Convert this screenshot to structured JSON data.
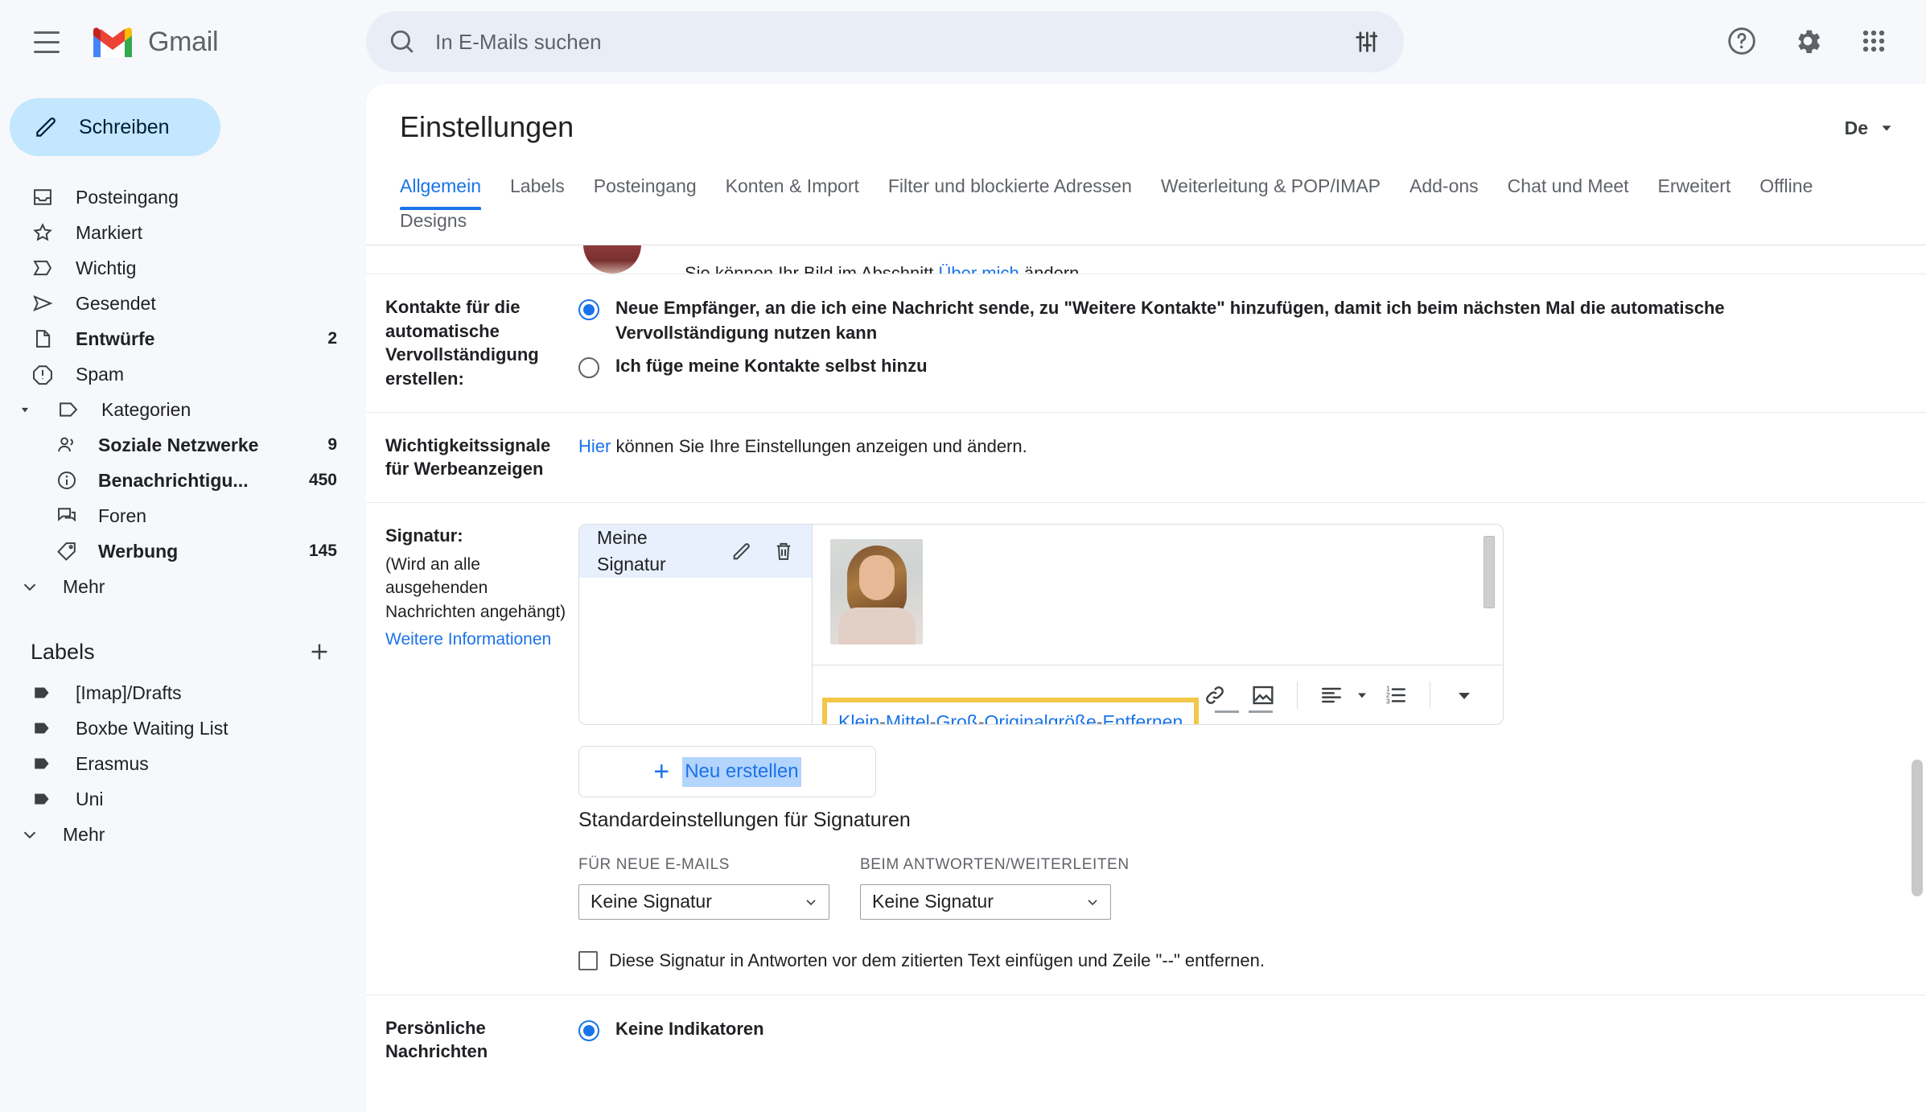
{
  "topbar": {
    "menu_icon": "hamburger-icon",
    "brand": "Gmail",
    "search": {
      "placeholder": "In E-Mails suchen",
      "value": "",
      "search_icon": "search-icon",
      "filter_icon": "tune-icon"
    },
    "help_icon": "help-circle-icon",
    "settings_icon": "gear-icon",
    "apps_icon": "apps-grid-icon"
  },
  "sidebar": {
    "compose": {
      "label": "Schreiben",
      "icon": "pencil-icon"
    },
    "items": [
      {
        "label": "Posteingang",
        "icon": "inbox-icon",
        "count": "",
        "bold": false
      },
      {
        "label": "Markiert",
        "icon": "star-icon",
        "count": "",
        "bold": false
      },
      {
        "label": "Wichtig",
        "icon": "important-icon",
        "count": "",
        "bold": false
      },
      {
        "label": "Gesendet",
        "icon": "send-icon",
        "count": "",
        "bold": false
      },
      {
        "label": "Entwürfe",
        "icon": "draft-icon",
        "count": "2",
        "bold": true
      },
      {
        "label": "Spam",
        "icon": "spam-icon",
        "count": "",
        "bold": false
      }
    ],
    "categories": {
      "label": "Kategorien",
      "icon": "label-icon",
      "expanded": true,
      "items": [
        {
          "label": "Soziale Netzwerke",
          "icon": "people-icon",
          "count": "9",
          "bold": true
        },
        {
          "label": "Benachrichtigu...",
          "icon": "info-icon",
          "count": "450",
          "bold": true
        },
        {
          "label": "Foren",
          "icon": "forum-icon",
          "count": "",
          "bold": false
        },
        {
          "label": "Werbung",
          "icon": "tag-icon",
          "count": "145",
          "bold": true
        }
      ],
      "more": "Mehr"
    },
    "labels_header": {
      "title": "Labels",
      "add_icon": "plus-icon"
    },
    "labels": [
      {
        "label": "[Imap]/Drafts",
        "icon": "label-filled-icon"
      },
      {
        "label": "Boxbe Waiting List",
        "icon": "label-filled-icon"
      },
      {
        "label": "Erasmus",
        "icon": "label-filled-icon"
      },
      {
        "label": "Uni",
        "icon": "label-filled-icon"
      }
    ],
    "labels_more": "Mehr"
  },
  "settings": {
    "title": "Einstellungen",
    "language": {
      "label": "De",
      "icon": "chevron-down-icon"
    },
    "tabs": [
      {
        "label": "Allgemein",
        "active": true
      },
      {
        "label": "Labels",
        "active": false
      },
      {
        "label": "Posteingang",
        "active": false
      },
      {
        "label": "Konten & Import",
        "active": false
      },
      {
        "label": "Filter und blockierte Adressen",
        "active": false
      },
      {
        "label": "Weiterleitung & POP/IMAP",
        "active": false
      },
      {
        "label": "Add-ons",
        "active": false
      },
      {
        "label": "Chat und Meet",
        "active": false
      },
      {
        "label": "Erweitert",
        "active": false
      },
      {
        "label": "Offline",
        "active": false
      },
      {
        "label": "Designs",
        "active": false
      }
    ],
    "clipped_row": {
      "text_before": "Sie können Ihr Bild im Abschnitt ",
      "link": "Über mich",
      "text_after": " ändern."
    },
    "contacts": {
      "label": "Kontakte für die automatische Vervollständigung erstellen:",
      "option1": "Neue Empfänger, an die ich eine Nachricht sende, zu \"Weitere Kontakte\" hinzufügen, damit ich beim nächsten Mal die automatische Vervollständigung nutzen kann",
      "option2": "Ich füge meine Kontakte selbst hinzu",
      "selected": 1
    },
    "importance": {
      "label": "Wichtigkeitssignale für Werbeanzeigen",
      "link": "Hier",
      "text": " können Sie Ihre Einstellungen anzeigen und ändern."
    },
    "signature": {
      "label": "Signatur:",
      "sub": "(Wird an alle ausgehenden Nachrichten angehängt)",
      "more_link": "Weitere Informationen",
      "list": [
        {
          "name": "Meine Signatur",
          "edit_icon": "pencil-icon",
          "delete_icon": "trash-icon",
          "selected": true
        }
      ],
      "image_alt": "portrait-photo",
      "size_links": [
        {
          "label": "Klein"
        },
        {
          "label": "Mittel"
        },
        {
          "label": "Groß"
        },
        {
          "label": "Originalgröße"
        },
        {
          "label": "Entfernen"
        }
      ],
      "size_separator": "-",
      "toolbar": [
        {
          "icon": "link-icon"
        },
        {
          "icon": "insert-image-icon"
        },
        {
          "icon": "align-left-icon"
        },
        {
          "icon": "numbered-list-icon"
        },
        {
          "icon": "more-options-icon"
        }
      ],
      "new_button": {
        "plus": "+",
        "label": "Neu erstellen"
      },
      "defaults_title": "Standardeinstellungen für Signaturen",
      "default_new": {
        "caption": "FÜR NEUE E-MAILS",
        "value": "Keine Signatur"
      },
      "default_reply": {
        "caption": "BEIM ANTWORTEN/WEITERLEITEN",
        "value": "Keine Signatur"
      },
      "checkbox_label": "Diese Signatur in Antworten vor dem zitierten Text einfügen und Zeile \"--\" entfernen.",
      "checkbox_checked": false
    },
    "personal": {
      "label": "Persönliche Nachrichten",
      "option1": "Keine Indikatoren",
      "selected": 1
    }
  },
  "colors": {
    "accent": "#1a73e8",
    "highlight": "#f2c74a",
    "compose_bg": "#c2e7ff",
    "selection": "#b3d4fd"
  }
}
